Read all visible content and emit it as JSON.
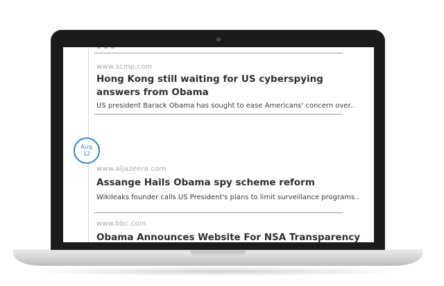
{
  "timeline": {
    "entries": [
      {
        "source": "www.scmp.com",
        "headline": "Hong Kong still waiting for US cyberspying answers from Obama",
        "summary": "US president Barack Obama has sought to ease Americans' concern over.."
      },
      {
        "source": "www.aljazeera.com",
        "headline": "Assange Hails Obama spy scheme reform",
        "summary": "Wikileaks founder calls US President's plans to limit surveillance programs.."
      },
      {
        "source": "www.bbc.com",
        "headline": "Obama Announces Website For NSA Transparency"
      }
    ],
    "date_badge": {
      "month": "Aug",
      "day": "12"
    }
  },
  "colors": {
    "accent": "#2f86c4",
    "headline": "#2f2f2f",
    "source": "#a9a9a9",
    "divider": "#9a9a9a",
    "bezel": "#1b1b1b"
  }
}
